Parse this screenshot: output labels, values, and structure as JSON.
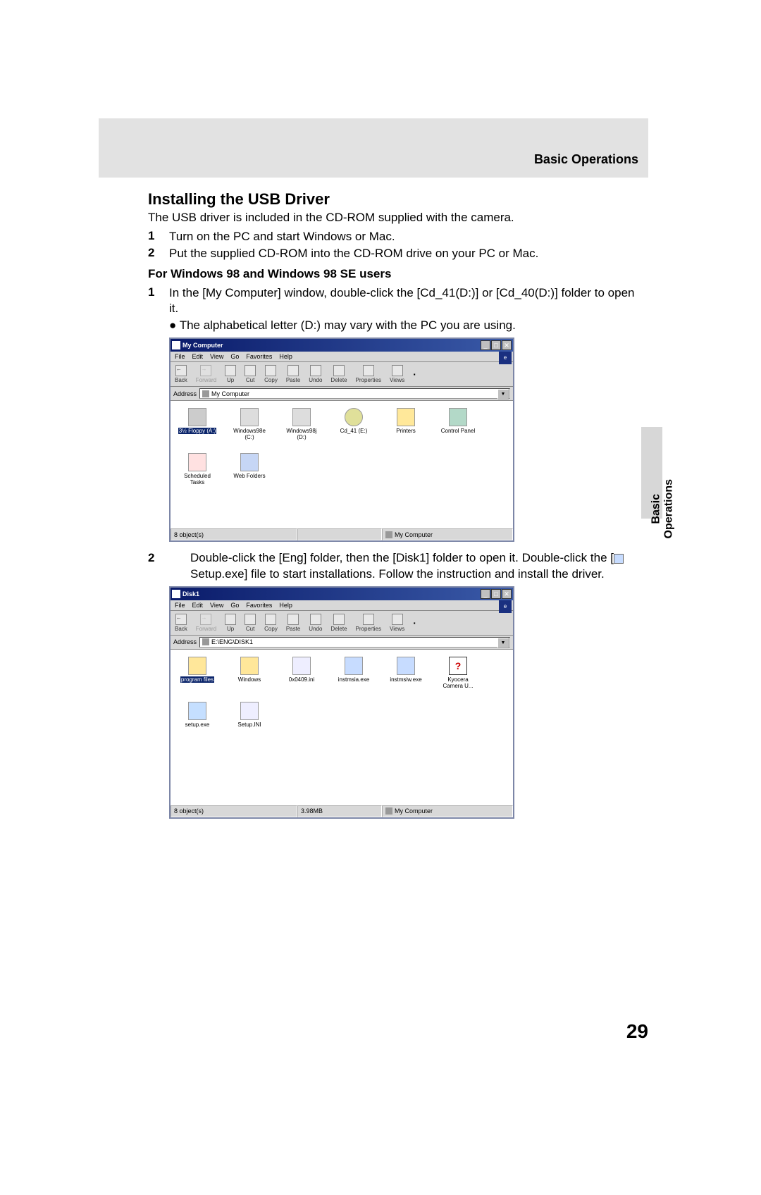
{
  "breadcrumb": "Basic Operations",
  "section_title": "Installing the USB Driver",
  "intro": "The USB driver is included in the CD-ROM supplied with the camera.",
  "steps_main": [
    {
      "n": "1",
      "t": "Turn on the PC and start Windows or Mac."
    },
    {
      "n": "2",
      "t": "Put the supplied CD-ROM into the CD-ROM drive on your PC or Mac."
    }
  ],
  "subhead": "For Windows 98 and Windows 98 SE users",
  "subsection_steps": [
    {
      "n": "1",
      "t": "In the [My Computer] window, double-click the [Cd_41(D:)] or [Cd_40(D:)] folder to open it."
    }
  ],
  "sub_bullet": "The alphabetical letter (D:) may vary with the PC you are using.",
  "win1": {
    "title": "My Computer",
    "menu": [
      "File",
      "Edit",
      "View",
      "Go",
      "Favorites",
      "Help"
    ],
    "toolbar": [
      {
        "label": "Back",
        "disabled": false
      },
      {
        "label": "Forward",
        "disabled": true
      },
      {
        "label": "Up",
        "disabled": false
      },
      {
        "label": "Cut",
        "disabled": false
      },
      {
        "label": "Copy",
        "disabled": false
      },
      {
        "label": "Paste",
        "disabled": false
      },
      {
        "label": "Undo",
        "disabled": false
      },
      {
        "label": "Delete",
        "disabled": false
      },
      {
        "label": "Properties",
        "disabled": false
      },
      {
        "label": "Views",
        "disabled": false
      }
    ],
    "address_label": "Address",
    "address_value": "My Computer",
    "items": [
      {
        "label": "3½ Floppy (A:)",
        "type": "floppy",
        "selected": true
      },
      {
        "label": "Windows98e (C:)",
        "type": "drive"
      },
      {
        "label": "Windows98j (D:)",
        "type": "drive"
      },
      {
        "label": "Cd_41 (E:)",
        "type": "cd"
      },
      {
        "label": "Printers",
        "type": "printer"
      },
      {
        "label": "Control Panel",
        "type": "cpanel"
      },
      {
        "label": "Scheduled Tasks",
        "type": "sched"
      },
      {
        "label": "Web Folders",
        "type": "web"
      }
    ],
    "status_left": "8 object(s)",
    "status_right": "My Computer"
  },
  "para2": {
    "n": "2",
    "t": "Double-click the [Eng] folder, then the [Disk1] folder to open it. Double-click the [",
    "file": "Setup.exe",
    "t2": "] file to start installations. Follow the instruction and install the driver."
  },
  "win2": {
    "title": "Disk1",
    "menu": [
      "File",
      "Edit",
      "View",
      "Go",
      "Favorites",
      "Help"
    ],
    "toolbar": [
      {
        "label": "Back",
        "disabled": false
      },
      {
        "label": "Forward",
        "disabled": true
      },
      {
        "label": "Up",
        "disabled": false
      },
      {
        "label": "Cut",
        "disabled": false
      },
      {
        "label": "Copy",
        "disabled": false
      },
      {
        "label": "Paste",
        "disabled": false
      },
      {
        "label": "Undo",
        "disabled": false
      },
      {
        "label": "Delete",
        "disabled": false
      },
      {
        "label": "Properties",
        "disabled": false
      },
      {
        "label": "Views",
        "disabled": false
      }
    ],
    "address_label": "Address",
    "address_value": "E:\\ENG\\DISK1",
    "items": [
      {
        "label": "program files",
        "type": "folder",
        "selected": true
      },
      {
        "label": "Windows",
        "type": "folder"
      },
      {
        "label": "0x0409.ini",
        "type": "ini"
      },
      {
        "label": "instmsia.exe",
        "type": "exe"
      },
      {
        "label": "instmsiw.exe",
        "type": "exe"
      },
      {
        "label": "Kyocera Camera U...",
        "type": "help"
      },
      {
        "label": "setup.exe",
        "type": "setup"
      },
      {
        "label": "Setup.INI",
        "type": "ini"
      }
    ],
    "status_left": "8 object(s)",
    "status_mid": "3.98MB",
    "status_right": "My Computer"
  },
  "side_tab_line1": "Basic",
  "side_tab_line2": "Operations",
  "page_number": "29"
}
